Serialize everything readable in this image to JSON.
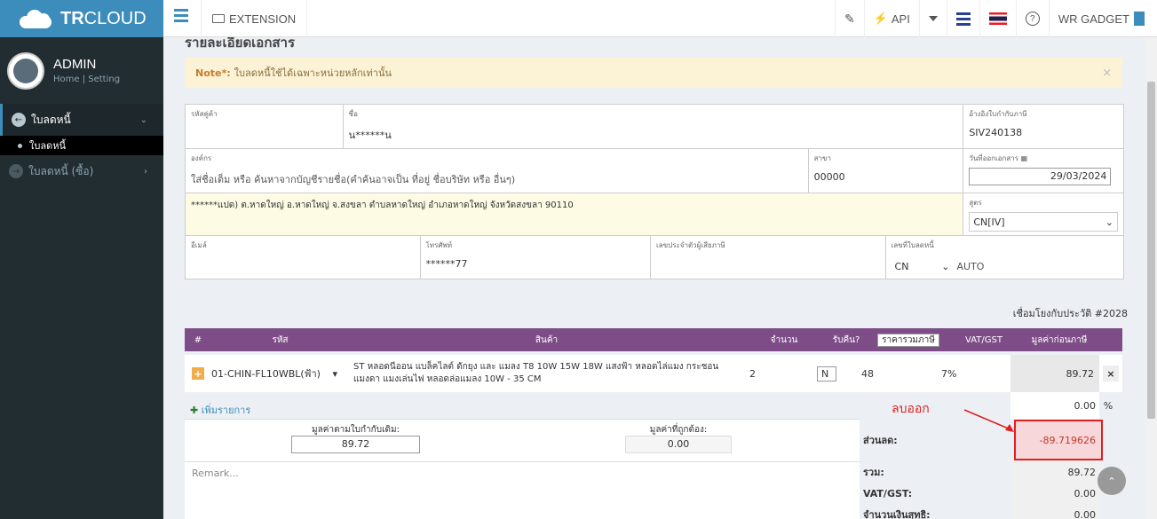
{
  "header": {
    "logo_bold": "TR",
    "logo_rest": "CLOUD",
    "extension_label": "EXTENSION",
    "notify_badge": "!",
    "api_label": "API",
    "company_label": "WR GADGET"
  },
  "sidebar": {
    "user_name": "ADMIN",
    "user_links": "Home | Setting",
    "menu_active": "ใบลดหนี้",
    "menu_sub": "ใบลดหนี้",
    "menu_other": "ใบลดหนี้ (ซื้อ)"
  },
  "page": {
    "title": "รายละเอียดเอกสาร",
    "note_bold": "Note*:",
    "note_text": "ใบลดหนี้ใช้ได้เฉพาะหน่วยหลักเท่านั้น",
    "note_close": "×"
  },
  "form": {
    "customer_code_label": "รหัสคู่ค้า",
    "customer_code_value": "",
    "name_label": "ชื่อ",
    "name_value": "น******น",
    "ref_invoice_label": "อ้างอิงใบกำกับภาษี",
    "ref_invoice_value": "SIV240138",
    "org_label": "องค์กร",
    "org_placeholder": "ใส่ชื่อเต็ม หรือ ค้นหาจากบัญชีรายชื่อ(คำค้นอาจเป็น ที่อยู่ ชื่อบริษัท หรือ อื่นๆ)",
    "branch_label": "สาขา",
    "branch_value": "00000",
    "issue_date_label": "วันที่ออกเอกสาร",
    "issue_date_value": "29/03/2024",
    "address_value": "******แปด) ต.หาดใหญ่ อ.หาดใหญ่ จ.สงขลา ตำบลหาดใหญ่ อำเภอหาดใหญ่ จังหวัดสงขลา 90110",
    "formula_label": "สูตร",
    "formula_value": "CN[IV]",
    "email_label": "อีเมล์",
    "email_value": "",
    "phone_label": "โทรศัพท์",
    "phone_value": "******77",
    "taxid_label": "เลขประจำตัวผู้เสียภาษี",
    "taxid_value": "",
    "cn_no_label": "เลขที่ใบลดหนี้",
    "cn_prefix": "CN",
    "cn_auto": "AUTO",
    "link_history": "เชื่อมโยงกับประวัติ #2028"
  },
  "table": {
    "headers": [
      "#",
      "รหัส",
      "สินค้า",
      "จำนวน",
      "รับคืน?",
      "ราคารวมภาษี",
      "VAT/GST",
      "มูลค่าก่อนภาษี"
    ],
    "row": {
      "code": "01-CHIN-FL10WBL(ฟ้า)",
      "product": "ST หลอดนีออน แบล็คไลต์ ดักยุง และ แมลง T8 10W 15W 18W แสงฟ้า หลอดไล่แมง กระชอน แมงดา แมงเล่นไฟ หลอดล่อแมลง 10W - 35 CM",
      "qty": "2",
      "return": "N",
      "price": "48",
      "vat": "7%",
      "amount": "89.72",
      "remove": "×"
    },
    "add_item": "เพิ่มรายการ"
  },
  "lower": {
    "orig_label": "มูลค่าตามใบกำกับเดิม:",
    "orig_value": "89.72",
    "correct_label": "มูลค่าที่ถูกต้อง:",
    "correct_value": "0.00",
    "remark_placeholder": "Remark..."
  },
  "summary": {
    "pct_value": "0.00",
    "pct_unit": "%",
    "discount_label": "ส่วนลด:",
    "discount_value": "-89.719626",
    "total_label": "รวม:",
    "total_value": "89.72",
    "vat_label": "VAT/GST:",
    "vat_value": "0.00",
    "net_label": "จำนวนเงินสุทธิ:",
    "net_value": "0.00"
  },
  "annotation": {
    "text": "ลบออก",
    "color": "#e02020"
  }
}
